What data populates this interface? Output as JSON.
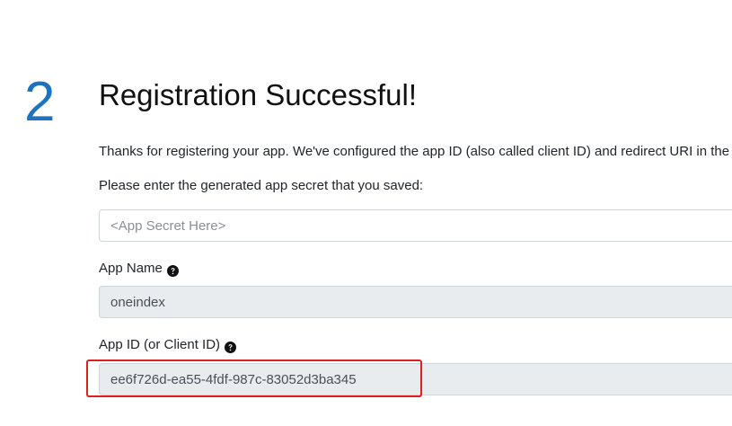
{
  "step": {
    "number": "2",
    "title": "Registration Successful!"
  },
  "intro_text": "Thanks for registering your app. We've configured the app ID (also called client ID) and redirect URI in the c",
  "prompt_text": "Please enter the generated app secret that you saved:",
  "fields": {
    "secret": {
      "placeholder": "<App Secret Here>",
      "value": ""
    },
    "app_name": {
      "label": "App Name",
      "value": "oneindex",
      "icon": "question-circle-icon"
    },
    "app_id": {
      "label": "App ID (or Client ID)",
      "value": "ee6f726d-ea55-4fdf-987c-83052d3ba345",
      "icon": "question-circle-icon"
    }
  },
  "colors": {
    "step_number": "#1e73be",
    "highlight_border": "#e02020",
    "readonly_bg": "#e9ecef"
  }
}
